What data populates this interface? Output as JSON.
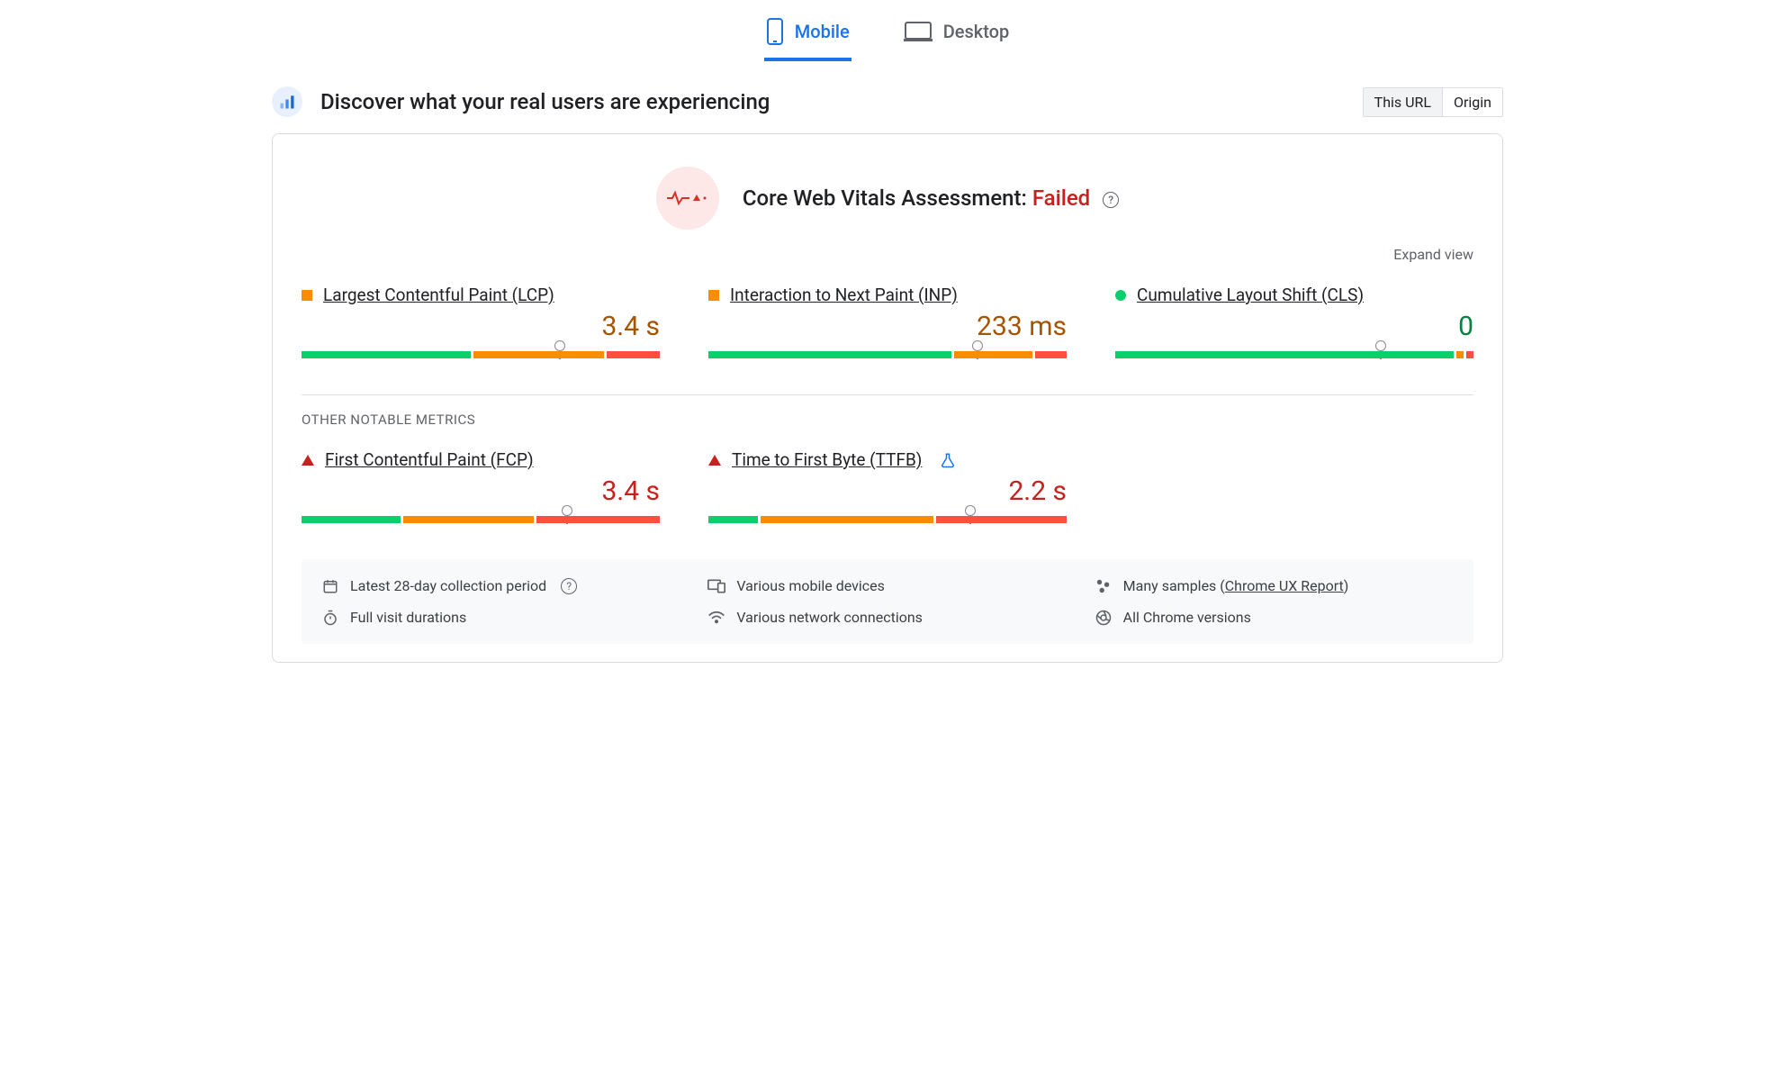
{
  "tabs": {
    "mobile": "Mobile",
    "desktop": "Desktop"
  },
  "header": {
    "title": "Discover what your real users are experiencing",
    "scope_url": "This URL",
    "scope_origin": "Origin"
  },
  "assessment": {
    "label": "Core Web Vitals Assessment: ",
    "status": "Failed"
  },
  "expand_view": "Expand view",
  "section_other": "OTHER NOTABLE METRICS",
  "metrics": {
    "lcp": {
      "name": "Largest Contentful Paint (LCP)",
      "value": "3.4 s",
      "status": "ni",
      "bar": {
        "good": 48,
        "ni": 37,
        "poor": 15
      },
      "marker": 72
    },
    "inp": {
      "name": "Interaction to Next Paint (INP)",
      "value": "233 ms",
      "status": "ni",
      "bar": {
        "good": 69,
        "ni": 22,
        "poor": 9
      },
      "marker": 75
    },
    "cls": {
      "name": "Cumulative Layout Shift (CLS)",
      "value": "0",
      "status": "good",
      "bar": {
        "good": 96,
        "ni": 2,
        "poor": 2
      },
      "marker": 74
    },
    "fcp": {
      "name": "First Contentful Paint (FCP)",
      "value": "3.4 s",
      "status": "poor",
      "bar": {
        "good": 28,
        "ni": 37,
        "poor": 35
      },
      "marker": 74
    },
    "ttfb": {
      "name": "Time to First Byte (TTFB)",
      "value": "2.2 s",
      "status": "poor",
      "bar": {
        "good": 14,
        "ni": 49,
        "poor": 37
      },
      "marker": 73
    }
  },
  "info": {
    "period": "Latest 28-day collection period",
    "devices": "Various mobile devices",
    "samples_prefix": "Many samples (",
    "samples_link": "Chrome UX Report",
    "samples_suffix": ")",
    "visits": "Full visit durations",
    "networks": "Various network connections",
    "versions": "All Chrome versions"
  }
}
